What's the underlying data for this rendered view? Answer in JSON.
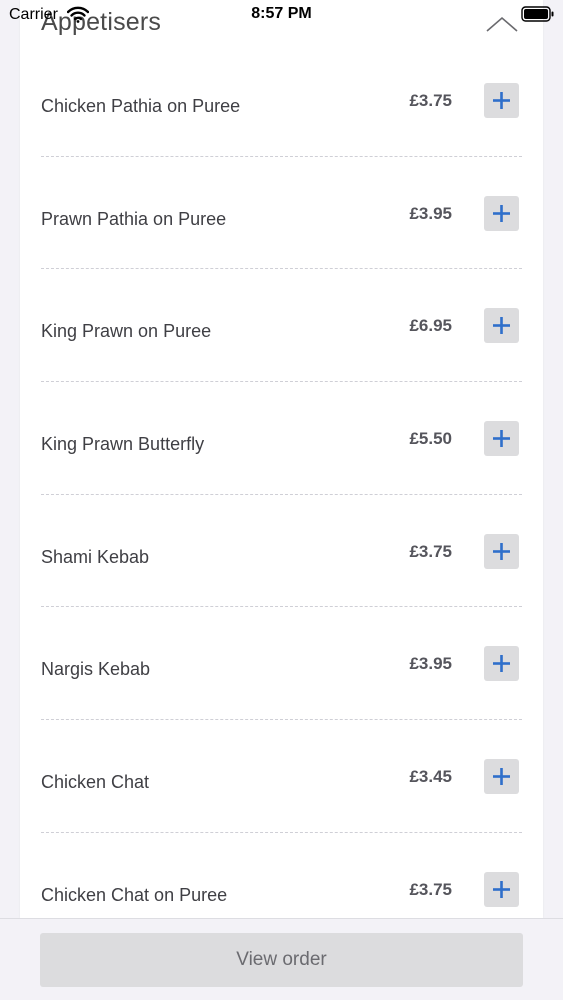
{
  "status_bar": {
    "carrier": "Carrier",
    "time": "8:57 PM"
  },
  "section": {
    "title": "Appetisers"
  },
  "items": [
    {
      "name": "Chicken Pathia on Puree",
      "price": "£3.75"
    },
    {
      "name": "Prawn Pathia on Puree",
      "price": "£3.95"
    },
    {
      "name": "King Prawn on Puree",
      "price": "£6.95"
    },
    {
      "name": "King Prawn Butterfly",
      "price": "£5.50"
    },
    {
      "name": "Shami Kebab",
      "price": "£3.75"
    },
    {
      "name": "Nargis Kebab",
      "price": "£3.95"
    },
    {
      "name": "Chicken Chat",
      "price": "£3.45"
    },
    {
      "name": "Chicken Chat on Puree",
      "price": "£3.75"
    }
  ],
  "bottom": {
    "view_order_label": "View order"
  },
  "colors": {
    "accent": "#2f6fcb",
    "button_bg": "#dcdcde",
    "background": "#f3f2f7"
  },
  "icons": {
    "collapse": "chevron-up-icon",
    "add": "plus-icon",
    "wifi": "wifi-icon",
    "battery": "battery-icon"
  }
}
